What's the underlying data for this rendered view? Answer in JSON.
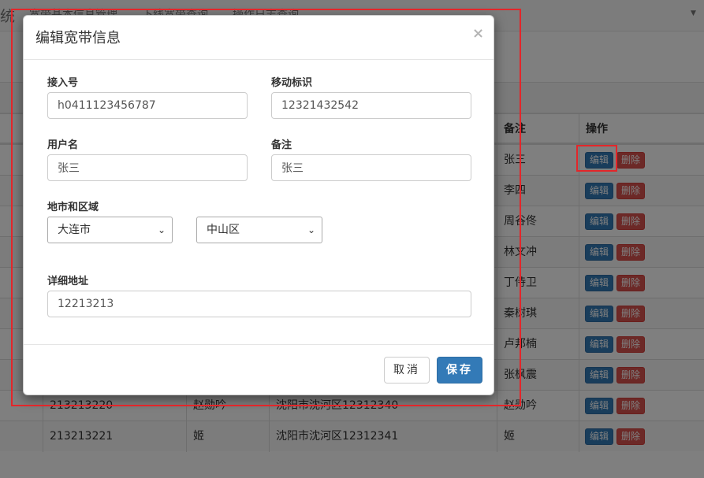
{
  "navbar": {
    "brand": "统",
    "links": [
      "宽带基本信息管理",
      "下线宽带查询",
      "操作日志查询"
    ]
  },
  "table": {
    "headers": {
      "remark": "备注",
      "action": "操作"
    },
    "rows": [
      {
        "id": "",
        "name": "",
        "address": "",
        "remark": "张三"
      },
      {
        "id": "",
        "name": "",
        "address": "",
        "remark": "李四"
      },
      {
        "id": "",
        "name": "",
        "address": "",
        "remark": "周谷佟"
      },
      {
        "id": "",
        "name": "",
        "address": "",
        "remark": "林文冲"
      },
      {
        "id": "",
        "name": "",
        "address": "",
        "remark": "丁侍卫"
      },
      {
        "id": "",
        "name": "",
        "address": "",
        "remark": "秦树琪"
      },
      {
        "id": "",
        "name": "",
        "address": "",
        "remark": "卢邦楠"
      },
      {
        "id": "",
        "name": "",
        "address": "",
        "remark": "张枫震"
      },
      {
        "id": "213213220",
        "name": "赵勋吟",
        "address": "沈阳市沈河区12312340",
        "remark": "赵勋吟"
      },
      {
        "id": "213213221",
        "name": "姬",
        "address": "沈阳市沈河区12312341",
        "remark": "姬"
      }
    ],
    "edit_label": "编辑",
    "delete_label": "删除"
  },
  "modal": {
    "title": "编辑宽带信息",
    "close": "×",
    "access_no_label": "接入号",
    "access_no_value": "h0411123456787",
    "mobile_id_label": "移动标识",
    "mobile_id_value": "12321432542",
    "username_label": "用户名",
    "username_value": "张三",
    "remark_label": "备注",
    "remark_value": "张三",
    "region_label": "地市和区域",
    "city_value": "大连市",
    "district_value": "中山区",
    "address_label": "详细地址",
    "address_value": "12213213",
    "cancel_label": "取消",
    "save_label": "保存"
  },
  "colors": {
    "primary": "#337ab7",
    "danger": "#d9534f",
    "annotation": "#e3262a"
  }
}
